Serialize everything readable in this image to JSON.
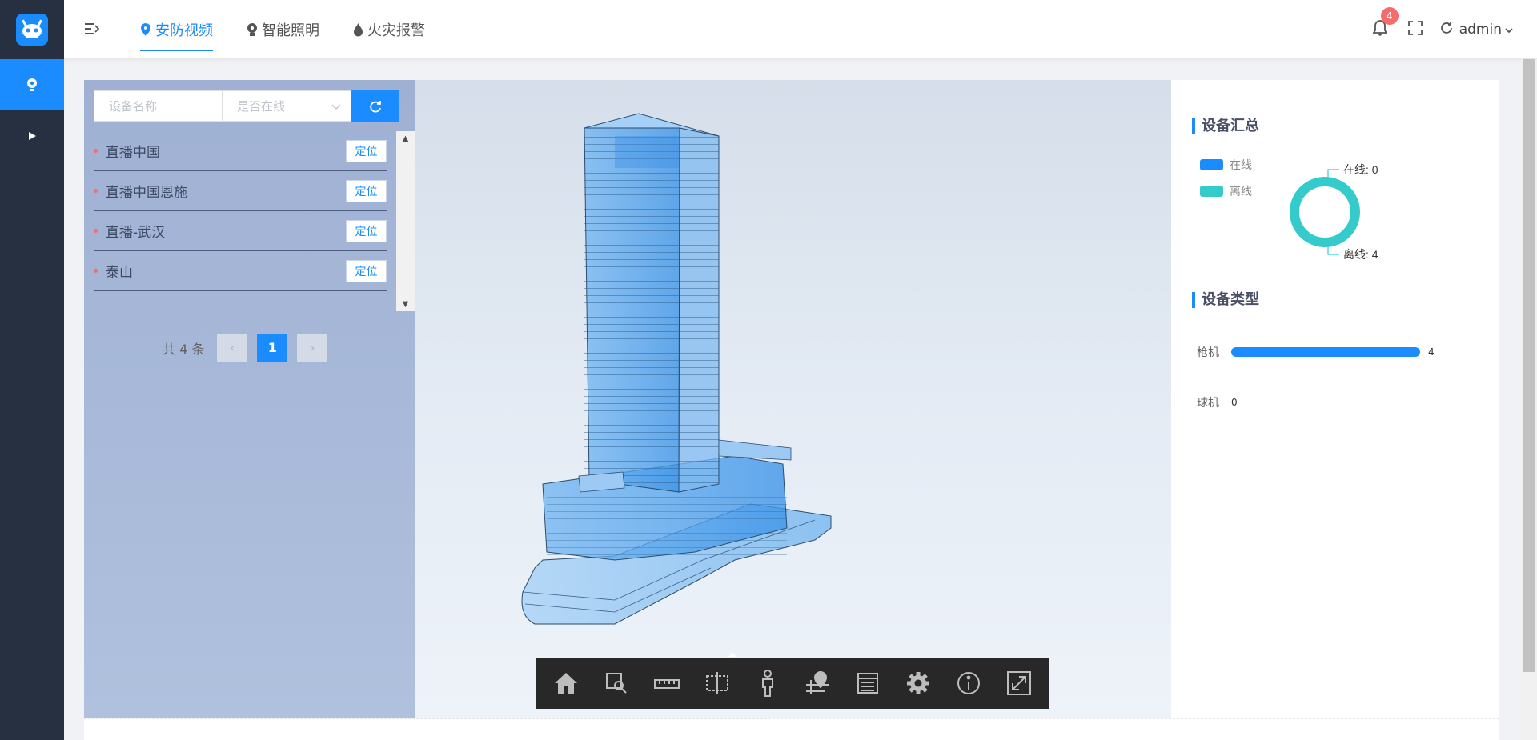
{
  "nav": {
    "tabs": [
      {
        "label": "安防视频",
        "icon": "camera-pin-icon",
        "active": true
      },
      {
        "label": "智能照明",
        "icon": "bulb-icon",
        "active": false
      },
      {
        "label": "火灾报警",
        "icon": "flame-icon",
        "active": false
      }
    ],
    "notification_count": "4",
    "username": "admin"
  },
  "filters": {
    "name_placeholder": "设备名称",
    "status_placeholder": "是否在线"
  },
  "devices": [
    {
      "name": "直播中国",
      "action": "定位"
    },
    {
      "name": "直播中国恩施",
      "action": "定位"
    },
    {
      "name": "直播-武汉",
      "action": "定位"
    },
    {
      "name": "泰山",
      "action": "定位"
    }
  ],
  "pagination": {
    "total_label": "共 4 条",
    "current_page": "1",
    "prev": "‹",
    "next": "›"
  },
  "summary": {
    "title": "设备汇总",
    "legend": [
      {
        "label": "在线",
        "color": "#1a8cff"
      },
      {
        "label": "离线",
        "color": "#36cbcb"
      }
    ],
    "online_label": "在线: 0",
    "offline_label": "离线: 4"
  },
  "types": {
    "title": "设备类型",
    "items": [
      {
        "label": "枪机",
        "value": "4",
        "fraction": 1.0
      },
      {
        "label": "球机",
        "value": "0",
        "fraction": 0.0
      }
    ]
  },
  "chart_data": {
    "type": "pie",
    "categories": [
      "在线",
      "离线"
    ],
    "values": [
      0,
      4
    ],
    "colors": [
      "#1a8cff",
      "#36cbcb"
    ]
  },
  "colors": {
    "accent": "#1a8cff",
    "rail": "#263040",
    "offline": "#36cbcb",
    "alert": "#f56c6c"
  },
  "toolbar_icons": [
    "home-icon",
    "zoom-area-icon",
    "ruler-icon",
    "section-box-icon",
    "person-icon",
    "location-pin-icon",
    "list-icon",
    "gear-icon",
    "info-icon",
    "fullscreen-expand-icon"
  ]
}
